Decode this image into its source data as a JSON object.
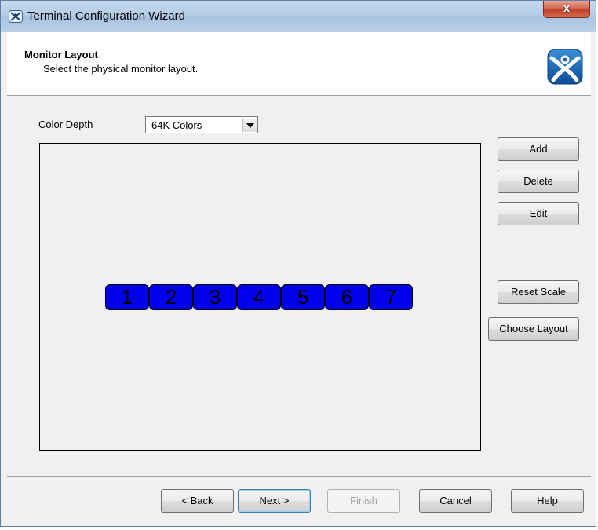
{
  "window": {
    "title": "Terminal Configuration Wizard",
    "close_label": "x"
  },
  "header": {
    "title": "Monitor Layout",
    "subtitle": "Select the physical monitor layout."
  },
  "color_depth": {
    "label": "Color Depth",
    "value": "64K Colors"
  },
  "monitors": [
    "1",
    "2",
    "3",
    "4",
    "5",
    "6",
    "7"
  ],
  "side_buttons": {
    "add": "Add",
    "delete": "Delete",
    "edit": "Edit",
    "reset_scale": "Reset Scale",
    "choose_layout": "Choose Layout"
  },
  "footer_buttons": {
    "back": "< Back",
    "next": "Next >",
    "finish": "Finish",
    "cancel": "Cancel",
    "help": "Help"
  },
  "colors": {
    "monitor_fill": "#0000ee",
    "titlebar": "#b9d1ea",
    "close_button": "#c9503b",
    "dialog_bg": "#f0f0f0"
  }
}
